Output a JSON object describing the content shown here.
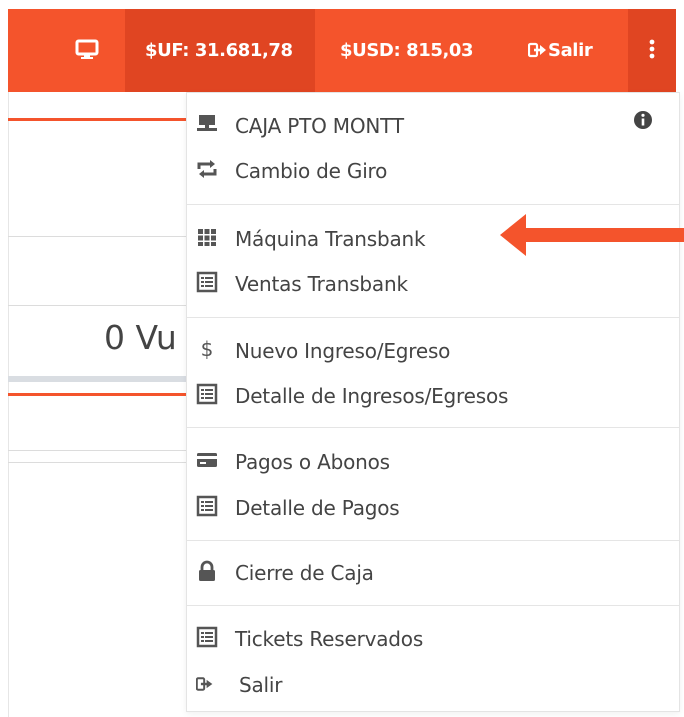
{
  "topbar": {
    "uf_label": "$UF: 31.681,78",
    "usd_label": "$USD: 815,03",
    "salir_label": "Salir",
    "accent_color": "#f4542c",
    "accent_dark": "#e04522"
  },
  "background": {
    "partial_text": "0 Vu"
  },
  "menu": {
    "items": [
      {
        "label": "CAJA PTO MONTT",
        "icon": "register-icon"
      },
      {
        "label": "Cambio de Giro",
        "icon": "exchange-icon"
      },
      {
        "label": "Máquina Transbank",
        "icon": "grid-icon"
      },
      {
        "label": "Ventas Transbank",
        "icon": "list-icon"
      },
      {
        "label": "Nuevo Ingreso/Egreso",
        "icon": "dollar-icon"
      },
      {
        "label": "Detalle de Ingresos/Egresos",
        "icon": "list-icon"
      },
      {
        "label": "Pagos o Abonos",
        "icon": "credit-card-icon"
      },
      {
        "label": "Detalle de Pagos",
        "icon": "list-icon"
      },
      {
        "label": "Cierre de Caja",
        "icon": "lock-icon"
      },
      {
        "label": "Tickets Reservados",
        "icon": "list-icon"
      },
      {
        "label": "Salir",
        "icon": "sign-out-icon"
      }
    ]
  }
}
